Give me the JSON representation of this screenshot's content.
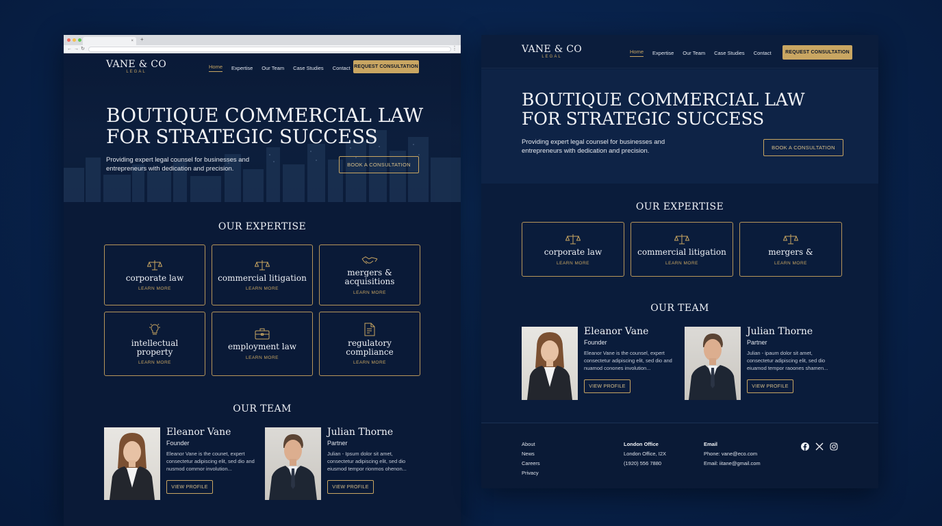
{
  "brand": {
    "name_left": "VANE & CO",
    "sub_left": "LEGAL",
    "name_right": "VANE & CO",
    "sub_right": "LEGAL"
  },
  "nav": {
    "links": [
      "Home",
      "Expertise",
      "Our Team",
      "Case Studies",
      "Contact"
    ],
    "cta": "REQUEST CONSULTATION"
  },
  "hero": {
    "title_line1": "BOUTIQUE COMMERCIAL LAW",
    "title_line2": "FOR STRATEGIC SUCCESS",
    "subtitle": "Providing expert legal counsel for businesses and entrepreneurs with dedication and precision.",
    "cta": "BOOK A CONSULTATION"
  },
  "expertise": {
    "title": "OUR EXPERTISE",
    "link_label": "LEARN MORE",
    "cards_left": [
      {
        "title": "corporate law",
        "icon": "scales-icon"
      },
      {
        "title": "commercial litigation",
        "icon": "scales-icon"
      },
      {
        "title": "mergers & acquisitions",
        "icon": "handshake-icon"
      },
      {
        "title": "intellectual property",
        "icon": "lightbulb-icon"
      },
      {
        "title": "employment law",
        "icon": "briefcase-icon"
      },
      {
        "title": "regulatory compliance",
        "icon": "document-icon"
      }
    ],
    "cards_right": [
      {
        "title": "corporate law",
        "icon": "scales-icon"
      },
      {
        "title": "commercial litigation",
        "icon": "scales-icon"
      },
      {
        "title": "mergers &",
        "icon": "scales-icon"
      }
    ]
  },
  "team": {
    "title": "OUR TEAM",
    "button": "VIEW PROFILE",
    "members": [
      {
        "name": "Eleanor Vane",
        "role": "Founder",
        "bio": "Eleanor Vane is the counsel, expert consectetur adipiscing elit, sed dio and nuamod conones involution..."
      },
      {
        "name": "Julian Thorne",
        "role": "Partner",
        "bio": "Julian - ipaum dolor sit amet, consectetur adipiscing elit, sed dio eiuamod tempor raoones shamen..."
      }
    ],
    "left_bios": [
      "Eleanor Vane is the counet, expert consectetur adipiscing elit, sed dio and nusmod commor involution...",
      "Julian - Ipsum dolor sit amet, consectetur adipiscing elit, sed dio eiusmod tempor rionmos ohenon..."
    ]
  },
  "footer": {
    "links": [
      "About",
      "News",
      "Careers",
      "Privacy"
    ],
    "office_title": "London Office",
    "office_lines": [
      "London Office, I2X",
      "(1920) 556 7880"
    ],
    "email_title": "Email",
    "email_lines": [
      "Phone: vane@eco.com",
      "Email: iitane@gmail.com"
    ],
    "social_icons": [
      "facebook-icon",
      "x-icon",
      "instagram-icon"
    ]
  },
  "colors": {
    "gold": "#c9a662",
    "navy": "#0a1c3b",
    "background": "#082149"
  }
}
